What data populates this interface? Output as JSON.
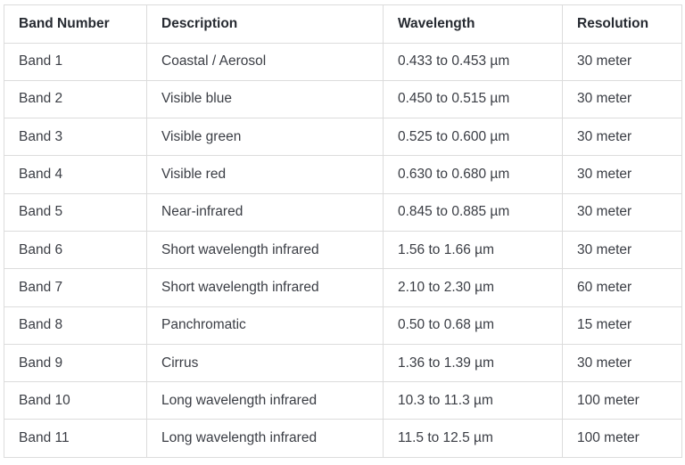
{
  "table": {
    "headers": [
      "Band Number",
      "Description",
      "Wavelength",
      "Resolution"
    ],
    "rows": [
      [
        "Band 1",
        "Coastal / Aerosol",
        "0.433 to 0.453 µm",
        "30 meter"
      ],
      [
        "Band 2",
        "Visible blue",
        "0.450 to 0.515 µm",
        "30 meter"
      ],
      [
        "Band 3",
        "Visible green",
        "0.525 to 0.600 µm",
        "30 meter"
      ],
      [
        "Band 4",
        "Visible red",
        "0.630 to 0.680 µm",
        "30 meter"
      ],
      [
        "Band 5",
        "Near-infrared",
        "0.845 to 0.885 µm",
        "30 meter"
      ],
      [
        "Band 6",
        "Short wavelength infrared",
        "1.56 to 1.66 µm",
        "30 meter"
      ],
      [
        "Band 7",
        "Short wavelength infrared",
        "2.10 to 2.30 µm",
        "60 meter"
      ],
      [
        "Band 8",
        "Panchromatic",
        "0.50 to 0.68 µm",
        "15 meter"
      ],
      [
        "Band 9",
        "Cirrus",
        "1.36 to 1.39 µm",
        "30 meter"
      ],
      [
        "Band 10",
        "Long wavelength infrared",
        "10.3 to 11.3 µm",
        "100 meter"
      ],
      [
        "Band 11",
        "Long wavelength infrared",
        "11.5 to 12.5 µm",
        "100 meter"
      ]
    ]
  }
}
